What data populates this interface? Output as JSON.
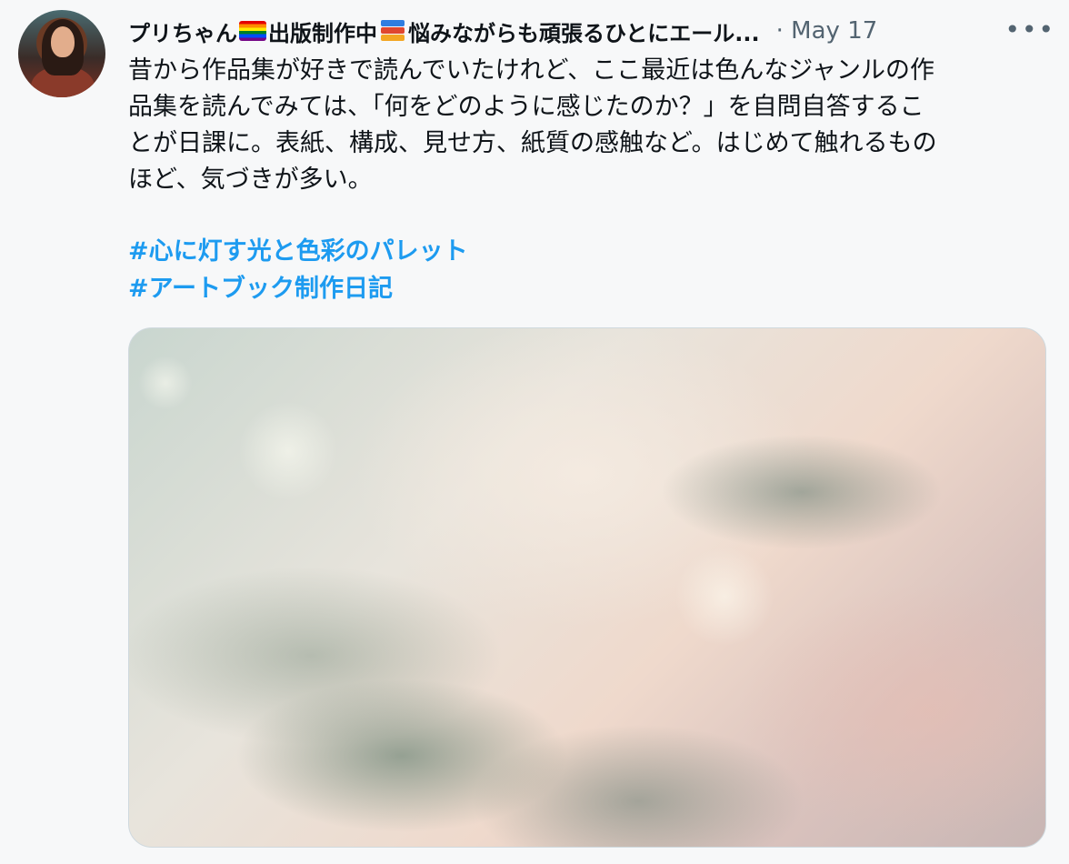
{
  "tweet": {
    "author": {
      "display_name_part1": "プリちゃん",
      "display_name_part2": "出版制作中",
      "display_name_part3": "悩みながらも頑張るひとにエール...",
      "emoji_1": "rainbow-flag-icon",
      "emoji_2": "books-icon"
    },
    "separator": "·",
    "date": "May 17",
    "more_label": "•••",
    "body": "昔から作品集が好きで読んでいたけれど、ここ最近は色んなジャンルの作\n品集を読んでみては、「何をどのように感じたのか？」を自問自答するこ\nとが日課に。表紙、構成、見せ方、紙質の感触など。はじめて触れるもの\nほど、気づきが多い。",
    "hashtags": [
      "#心に灯す光と色彩のパレット",
      "#アートブック制作日記"
    ],
    "colors": {
      "hashtag": "#1d9bf0",
      "muted": "#536471"
    }
  }
}
